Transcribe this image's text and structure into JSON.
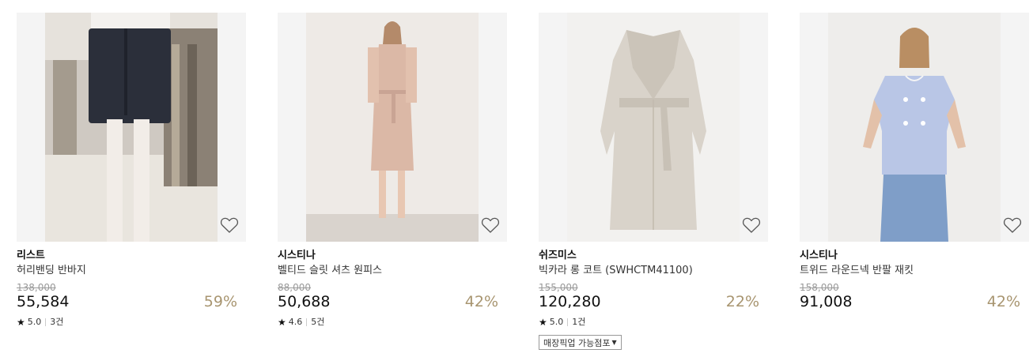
{
  "products": [
    {
      "brand": "리스트",
      "name": "허리밴딩 반바지",
      "original_price": "138,000",
      "price": "55,584",
      "discount": "59%",
      "rating": "5.0",
      "reviews": "3건"
    },
    {
      "brand": "시스티나",
      "name": "벨티드 슬릿 셔츠 원피스",
      "original_price": "88,000",
      "price": "50,688",
      "discount": "42%",
      "rating": "4.6",
      "reviews": "5건"
    },
    {
      "brand": "쉬즈미스",
      "name": "빅카라 롱 코트 (SWHCTM41100)",
      "original_price": "155,000",
      "price": "120,280",
      "discount": "22%",
      "rating": "5.0",
      "reviews": "1건",
      "pickup_label": "매장픽업 가능점포"
    },
    {
      "brand": "시스티나",
      "name": "트위드 라운드넥 반팔 재킷",
      "original_price": "158,000",
      "price": "91,008",
      "discount": "42%"
    }
  ],
  "icons": {
    "wishlist": "heart-outline-icon",
    "rating": "star-icon",
    "dropdown": "caret-down-icon"
  },
  "colors": {
    "discount": "#a89570",
    "original_price": "#999999",
    "thumbnail_bg": "#f4f4f4"
  }
}
